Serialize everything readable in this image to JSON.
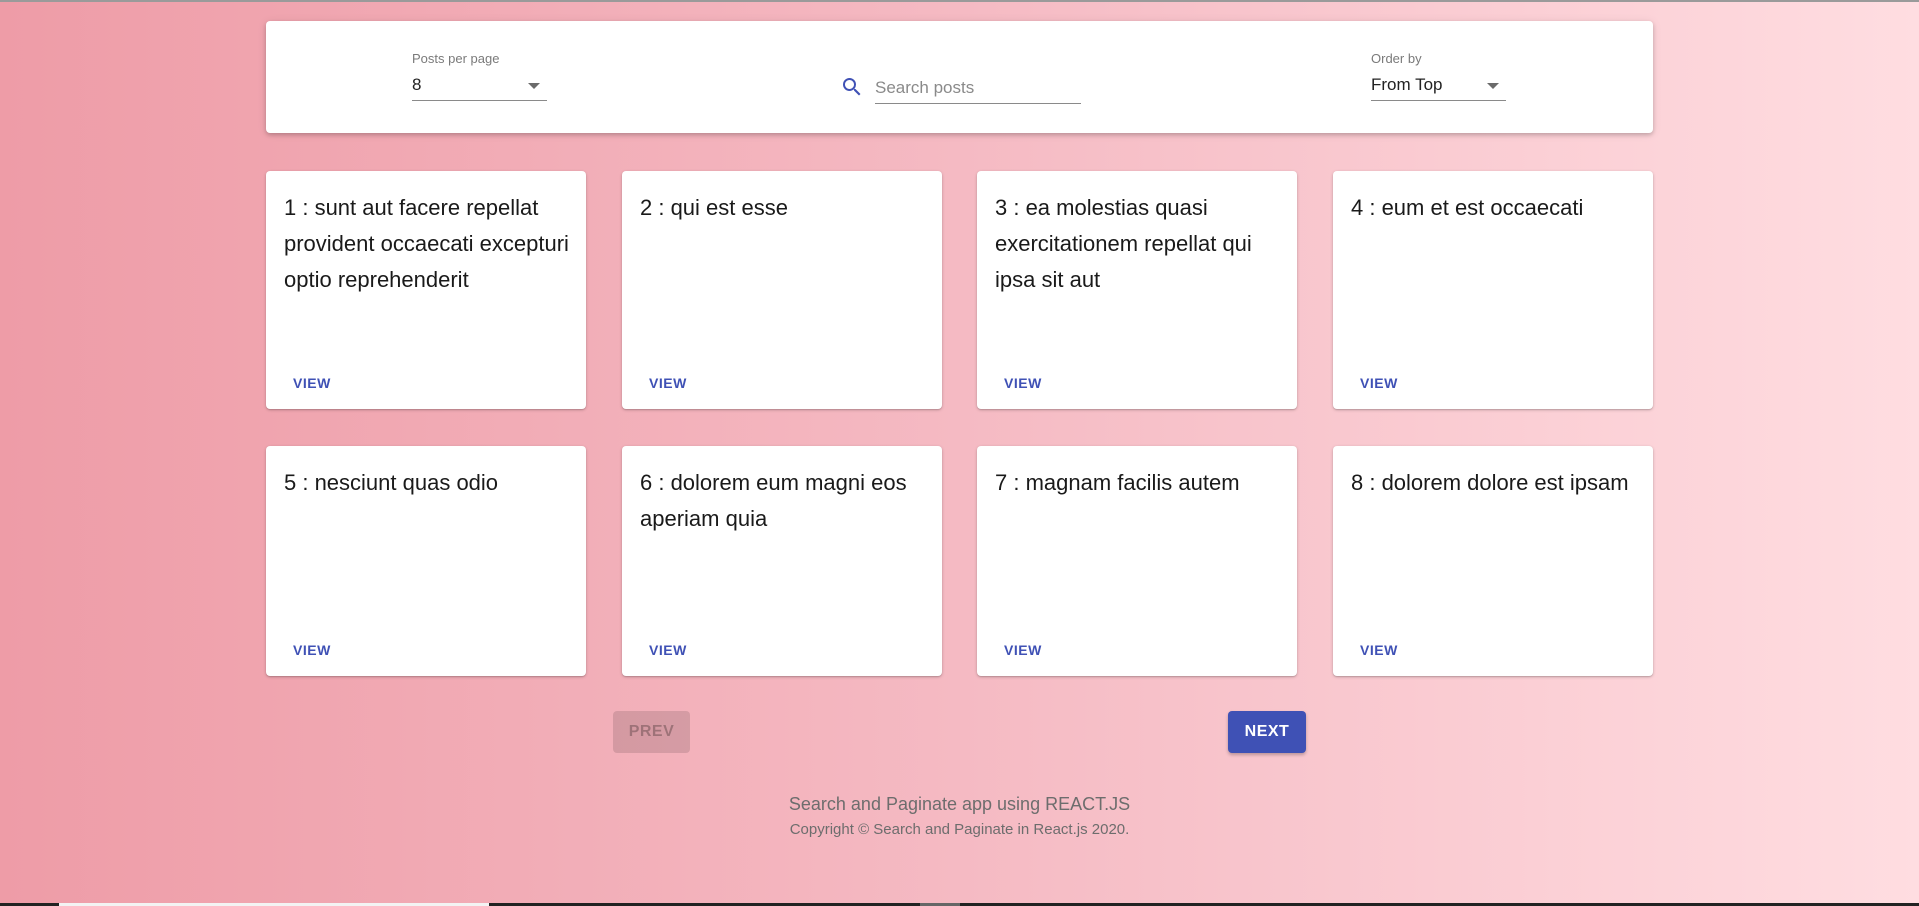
{
  "toolbar": {
    "posts_per_page_label": "Posts per page",
    "posts_per_page_value": "8",
    "search_placeholder": "Search posts",
    "order_by_label": "Order by",
    "order_by_value": "From Top"
  },
  "posts": [
    {
      "title": "1 : sunt aut facere repellat provident occaecati excepturi optio reprehenderit",
      "action": "VIEW"
    },
    {
      "title": "2 : qui est esse",
      "action": "VIEW"
    },
    {
      "title": "3 : ea molestias quasi exercitationem repellat qui ipsa sit aut",
      "action": "VIEW"
    },
    {
      "title": "4 : eum et est occaecati",
      "action": "VIEW"
    },
    {
      "title": "5 : nesciunt quas odio",
      "action": "VIEW"
    },
    {
      "title": "6 : dolorem eum magni eos aperiam quia",
      "action": "VIEW"
    },
    {
      "title": "7 : magnam facilis autem",
      "action": "VIEW"
    },
    {
      "title": "8 : dolorem dolore est ipsam",
      "action": "VIEW"
    }
  ],
  "pagination": {
    "prev_label": "PREV",
    "next_label": "NEXT"
  },
  "footer": {
    "tagline": "Search and Paginate app using REACT.JS",
    "copyright": "Copyright © Search and Paginate in React.js 2020."
  },
  "colors": {
    "accent": "#3f51b5",
    "background_start": "#ee9ca7",
    "background_end": "#ffdde1"
  },
  "icons": {
    "search": "search-icon",
    "dropdown": "chevron-down-icon"
  }
}
